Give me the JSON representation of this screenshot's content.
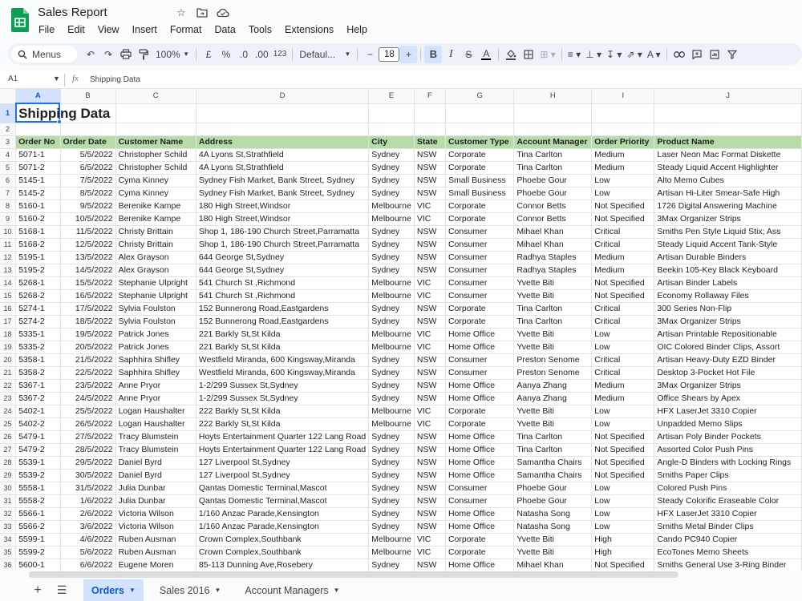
{
  "app": {
    "doc_title": "Sales Report",
    "logo_color": "#0f9d58"
  },
  "menu": [
    "File",
    "Edit",
    "View",
    "Insert",
    "Format",
    "Data",
    "Tools",
    "Extensions",
    "Help"
  ],
  "toolbar": {
    "search_label": "Menus",
    "zoom": "100%",
    "currency": "£",
    "percent": "%",
    "decimal_decrease": ".0",
    "decimal_increase": ".00",
    "format_123": "123",
    "font": "Defaul...",
    "font_size": "18"
  },
  "formula_bar": {
    "cell_ref": "A1",
    "content": "Shipping Data"
  },
  "columns": [
    "A",
    "B",
    "C",
    "D",
    "E",
    "F",
    "G",
    "H",
    "I",
    "J"
  ],
  "title": "Shipping Data",
  "headers": [
    "Order No",
    "Order Date",
    "Customer Name",
    "Address",
    "City",
    "State",
    "Customer Type",
    "Account Manager",
    "Order Priority",
    "Product Name"
  ],
  "rows": [
    [
      "5071-1",
      "5/5/2022",
      "Christopher Schild",
      "4A Lyons St,Strathfield",
      "Sydney",
      "NSW",
      "Corporate",
      "Tina Carlton",
      "Medium",
      "Laser Neon Mac Format Diskette"
    ],
    [
      "5071-2",
      "6/5/2022",
      "Christopher Schild",
      "4A Lyons St,Strathfield",
      "Sydney",
      "NSW",
      "Corporate",
      "Tina Carlton",
      "Medium",
      "Steady Liquid Accent Highlighter"
    ],
    [
      "5145-1",
      "7/5/2022",
      "Cyma Kinney",
      "Sydney Fish Market, Bank Street, Sydney",
      "Sydney",
      "NSW",
      "Small Business",
      "Phoebe Gour",
      "Low",
      "Alto Memo Cubes"
    ],
    [
      "5145-2",
      "8/5/2022",
      "Cyma Kinney",
      "Sydney Fish Market, Bank Street, Sydney",
      "Sydney",
      "NSW",
      "Small Business",
      "Phoebe Gour",
      "Low",
      "Artisan Hi-Liter Smear-Safe High"
    ],
    [
      "5160-1",
      "9/5/2022",
      "Berenike Kampe",
      "180 High Street,Windsor",
      "Melbourne",
      "VIC",
      "Corporate",
      "Connor Betts",
      "Not Specified",
      "1726 Digital Answering Machine"
    ],
    [
      "5160-2",
      "10/5/2022",
      "Berenike Kampe",
      "180 High Street,Windsor",
      "Melbourne",
      "VIC",
      "Corporate",
      "Connor Betts",
      "Not Specified",
      "3Max Organizer Strips"
    ],
    [
      "5168-1",
      "11/5/2022",
      "Christy Brittain",
      "Shop 1, 186-190 Church Street,Parramatta",
      "Sydney",
      "NSW",
      "Consumer",
      "Mihael Khan",
      "Critical",
      "Smiths Pen Style Liquid Stix; Ass"
    ],
    [
      "5168-2",
      "12/5/2022",
      "Christy Brittain",
      "Shop 1, 186-190 Church Street,Parramatta",
      "Sydney",
      "NSW",
      "Consumer",
      "Mihael Khan",
      "Critical",
      "Steady Liquid Accent Tank-Style"
    ],
    [
      "5195-1",
      "13/5/2022",
      "Alex Grayson",
      "644 George St,Sydney",
      "Sydney",
      "NSW",
      "Consumer",
      "Radhya Staples",
      "Medium",
      "Artisan Durable Binders"
    ],
    [
      "5195-2",
      "14/5/2022",
      "Alex Grayson",
      "644 George St,Sydney",
      "Sydney",
      "NSW",
      "Consumer",
      "Radhya Staples",
      "Medium",
      "Beekin 105-Key Black Keyboard"
    ],
    [
      "5268-1",
      "15/5/2022",
      "Stephanie Ulpright",
      "541 Church St ,Richmond",
      "Melbourne",
      "VIC",
      "Consumer",
      "Yvette Biti",
      "Not Specified",
      "Artisan Binder Labels"
    ],
    [
      "5268-2",
      "16/5/2022",
      "Stephanie Ulpright",
      "541 Church St ,Richmond",
      "Melbourne",
      "VIC",
      "Consumer",
      "Yvette Biti",
      "Not Specified",
      "Economy Rollaway Files"
    ],
    [
      "5274-1",
      "17/5/2022",
      "Sylvia Foulston",
      "152 Bunnerong Road,Eastgardens",
      "Sydney",
      "NSW",
      "Corporate",
      "Tina Carlton",
      "Critical",
      "300 Series Non-Flip"
    ],
    [
      "5274-2",
      "18/5/2022",
      "Sylvia Foulston",
      "152 Bunnerong Road,Eastgardens",
      "Sydney",
      "NSW",
      "Corporate",
      "Tina Carlton",
      "Critical",
      "3Max Organizer Strips"
    ],
    [
      "5335-1",
      "19/5/2022",
      "Patrick Jones",
      "221 Barkly St,St Kilda",
      "Melbourne",
      "VIC",
      "Home Office",
      "Yvette Biti",
      "Low",
      "Artisan Printable Repositionable"
    ],
    [
      "5335-2",
      "20/5/2022",
      "Patrick Jones",
      "221 Barkly St,St Kilda",
      "Melbourne",
      "VIC",
      "Home Office",
      "Yvette Biti",
      "Low",
      "OIC Colored Binder Clips, Assort"
    ],
    [
      "5358-1",
      "21/5/2022",
      "Saphhira Shifley",
      "Westfield Miranda, 600 Kingsway,Miranda",
      "Sydney",
      "NSW",
      "Consumer",
      "Preston Senome",
      "Critical",
      "Artisan Heavy-Duty EZD  Binder"
    ],
    [
      "5358-2",
      "22/5/2022",
      "Saphhira Shifley",
      "Westfield Miranda, 600 Kingsway,Miranda",
      "Sydney",
      "NSW",
      "Consumer",
      "Preston Senome",
      "Critical",
      "Desktop 3-Pocket Hot File"
    ],
    [
      "5367-1",
      "23/5/2022",
      "Anne Pryor",
      "1-2/299 Sussex St,Sydney",
      "Sydney",
      "NSW",
      "Home Office",
      "Aanya Zhang",
      "Medium",
      "3Max Organizer Strips"
    ],
    [
      "5367-2",
      "24/5/2022",
      "Anne Pryor",
      "1-2/299 Sussex St,Sydney",
      "Sydney",
      "NSW",
      "Home Office",
      "Aanya Zhang",
      "Medium",
      "Office Shears by Apex"
    ],
    [
      "5402-1",
      "25/5/2022",
      "Logan Haushalter",
      "222 Barkly St,St Kilda",
      "Melbourne",
      "VIC",
      "Corporate",
      "Yvette Biti",
      "Low",
      "HFX LaserJet 3310 Copier"
    ],
    [
      "5402-2",
      "26/5/2022",
      "Logan Haushalter",
      "222 Barkly St,St Kilda",
      "Melbourne",
      "VIC",
      "Corporate",
      "Yvette Biti",
      "Low",
      "Unpadded Memo Slips"
    ],
    [
      "5479-1",
      "27/5/2022",
      "Tracy Blumstein",
      "Hoyts Entertainment Quarter 122 Lang Road",
      "Sydney",
      "NSW",
      "Home Office",
      "Tina Carlton",
      "Not Specified",
      "Artisan Poly Binder Pockets"
    ],
    [
      "5479-2",
      "28/5/2022",
      "Tracy Blumstein",
      "Hoyts Entertainment Quarter 122 Lang Road",
      "Sydney",
      "NSW",
      "Home Office",
      "Tina Carlton",
      "Not Specified",
      "Assorted Color Push Pins"
    ],
    [
      "5539-1",
      "29/5/2022",
      "Daniel Byrd",
      "127 Liverpool St,Sydney",
      "Sydney",
      "NSW",
      "Home Office",
      "Samantha Chairs",
      "Not Specified",
      "Angle-D Binders with Locking Rings"
    ],
    [
      "5539-2",
      "30/5/2022",
      "Daniel Byrd",
      "127 Liverpool St,Sydney",
      "Sydney",
      "NSW",
      "Home Office",
      "Samantha Chairs",
      "Not Specified",
      "Smiths Paper Clips"
    ],
    [
      "5558-1",
      "31/5/2022",
      "Julia Dunbar",
      "Qantas Domestic Terminal,Mascot",
      "Sydney",
      "NSW",
      "Consumer",
      "Phoebe Gour",
      "Low",
      "Colored Push Pins"
    ],
    [
      "5558-2",
      "1/6/2022",
      "Julia Dunbar",
      "Qantas Domestic Terminal,Mascot",
      "Sydney",
      "NSW",
      "Consumer",
      "Phoebe Gour",
      "Low",
      "Steady Colorific Eraseable Color"
    ],
    [
      "5566-1",
      "2/6/2022",
      "Victoria Wilson",
      "1/160 Anzac Parade,Kensington",
      "Sydney",
      "NSW",
      "Home Office",
      "Natasha Song",
      "Low",
      "HFX LaserJet 3310 Copier"
    ],
    [
      "5566-2",
      "3/6/2022",
      "Victoria Wilson",
      "1/160 Anzac Parade,Kensington",
      "Sydney",
      "NSW",
      "Home Office",
      "Natasha Song",
      "Low",
      "Smiths Metal Binder Clips"
    ],
    [
      "5599-1",
      "4/6/2022",
      "Ruben Ausman",
      "Crown Complex,Southbank",
      "Melbourne",
      "VIC",
      "Corporate",
      "Yvette Biti",
      "High",
      "Cando PC940 Copier"
    ],
    [
      "5599-2",
      "5/6/2022",
      "Ruben Ausman",
      "Crown Complex,Southbank",
      "Melbourne",
      "VIC",
      "Corporate",
      "Yvette Biti",
      "High",
      "EcoTones Memo Sheets"
    ],
    [
      "5600-1",
      "6/6/2022",
      "Eugene Moren",
      "85-113 Dunning Ave,Rosebery",
      "Sydney",
      "NSW",
      "Home Office",
      "Mihael Khan",
      "Not Specified",
      "Smiths General Use 3-Ring Binder"
    ]
  ],
  "row_numbers": [
    "1",
    "2",
    "3",
    "4",
    "5",
    "6",
    "7",
    "8",
    "9",
    "10",
    "11",
    "12",
    "13",
    "14",
    "15",
    "16",
    "17",
    "18",
    "19",
    "20",
    "21",
    "22",
    "23",
    "24",
    "25",
    "26",
    "27",
    "28",
    "29",
    "30",
    "31",
    "32",
    "33",
    "34",
    "35",
    "36"
  ],
  "sheet_tabs": [
    {
      "label": "Orders",
      "active": true
    },
    {
      "label": "Sales 2016",
      "active": false
    },
    {
      "label": "Account Managers",
      "active": false
    }
  ],
  "colors": {
    "header_fill": "#b7dcaa",
    "selection": "#1a73e8",
    "active_tab": "#d3e3fd"
  }
}
